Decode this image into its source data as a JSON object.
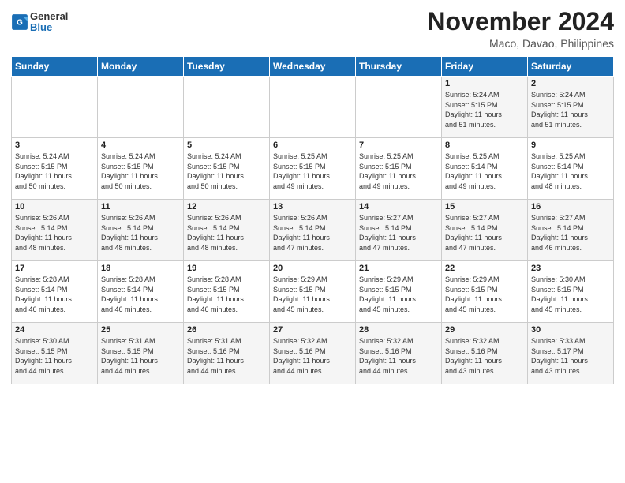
{
  "header": {
    "logo_line1": "General",
    "logo_line2": "Blue",
    "month": "November 2024",
    "location": "Maco, Davao, Philippines"
  },
  "days_of_week": [
    "Sunday",
    "Monday",
    "Tuesday",
    "Wednesday",
    "Thursday",
    "Friday",
    "Saturday"
  ],
  "weeks": [
    [
      {
        "day": "",
        "info": ""
      },
      {
        "day": "",
        "info": ""
      },
      {
        "day": "",
        "info": ""
      },
      {
        "day": "",
        "info": ""
      },
      {
        "day": "",
        "info": ""
      },
      {
        "day": "1",
        "info": "Sunrise: 5:24 AM\nSunset: 5:15 PM\nDaylight: 11 hours\nand 51 minutes."
      },
      {
        "day": "2",
        "info": "Sunrise: 5:24 AM\nSunset: 5:15 PM\nDaylight: 11 hours\nand 51 minutes."
      }
    ],
    [
      {
        "day": "3",
        "info": "Sunrise: 5:24 AM\nSunset: 5:15 PM\nDaylight: 11 hours\nand 50 minutes."
      },
      {
        "day": "4",
        "info": "Sunrise: 5:24 AM\nSunset: 5:15 PM\nDaylight: 11 hours\nand 50 minutes."
      },
      {
        "day": "5",
        "info": "Sunrise: 5:24 AM\nSunset: 5:15 PM\nDaylight: 11 hours\nand 50 minutes."
      },
      {
        "day": "6",
        "info": "Sunrise: 5:25 AM\nSunset: 5:15 PM\nDaylight: 11 hours\nand 49 minutes."
      },
      {
        "day": "7",
        "info": "Sunrise: 5:25 AM\nSunset: 5:15 PM\nDaylight: 11 hours\nand 49 minutes."
      },
      {
        "day": "8",
        "info": "Sunrise: 5:25 AM\nSunset: 5:14 PM\nDaylight: 11 hours\nand 49 minutes."
      },
      {
        "day": "9",
        "info": "Sunrise: 5:25 AM\nSunset: 5:14 PM\nDaylight: 11 hours\nand 48 minutes."
      }
    ],
    [
      {
        "day": "10",
        "info": "Sunrise: 5:26 AM\nSunset: 5:14 PM\nDaylight: 11 hours\nand 48 minutes."
      },
      {
        "day": "11",
        "info": "Sunrise: 5:26 AM\nSunset: 5:14 PM\nDaylight: 11 hours\nand 48 minutes."
      },
      {
        "day": "12",
        "info": "Sunrise: 5:26 AM\nSunset: 5:14 PM\nDaylight: 11 hours\nand 48 minutes."
      },
      {
        "day": "13",
        "info": "Sunrise: 5:26 AM\nSunset: 5:14 PM\nDaylight: 11 hours\nand 47 minutes."
      },
      {
        "day": "14",
        "info": "Sunrise: 5:27 AM\nSunset: 5:14 PM\nDaylight: 11 hours\nand 47 minutes."
      },
      {
        "day": "15",
        "info": "Sunrise: 5:27 AM\nSunset: 5:14 PM\nDaylight: 11 hours\nand 47 minutes."
      },
      {
        "day": "16",
        "info": "Sunrise: 5:27 AM\nSunset: 5:14 PM\nDaylight: 11 hours\nand 46 minutes."
      }
    ],
    [
      {
        "day": "17",
        "info": "Sunrise: 5:28 AM\nSunset: 5:14 PM\nDaylight: 11 hours\nand 46 minutes."
      },
      {
        "day": "18",
        "info": "Sunrise: 5:28 AM\nSunset: 5:14 PM\nDaylight: 11 hours\nand 46 minutes."
      },
      {
        "day": "19",
        "info": "Sunrise: 5:28 AM\nSunset: 5:15 PM\nDaylight: 11 hours\nand 46 minutes."
      },
      {
        "day": "20",
        "info": "Sunrise: 5:29 AM\nSunset: 5:15 PM\nDaylight: 11 hours\nand 45 minutes."
      },
      {
        "day": "21",
        "info": "Sunrise: 5:29 AM\nSunset: 5:15 PM\nDaylight: 11 hours\nand 45 minutes."
      },
      {
        "day": "22",
        "info": "Sunrise: 5:29 AM\nSunset: 5:15 PM\nDaylight: 11 hours\nand 45 minutes."
      },
      {
        "day": "23",
        "info": "Sunrise: 5:30 AM\nSunset: 5:15 PM\nDaylight: 11 hours\nand 45 minutes."
      }
    ],
    [
      {
        "day": "24",
        "info": "Sunrise: 5:30 AM\nSunset: 5:15 PM\nDaylight: 11 hours\nand 44 minutes."
      },
      {
        "day": "25",
        "info": "Sunrise: 5:31 AM\nSunset: 5:15 PM\nDaylight: 11 hours\nand 44 minutes."
      },
      {
        "day": "26",
        "info": "Sunrise: 5:31 AM\nSunset: 5:16 PM\nDaylight: 11 hours\nand 44 minutes."
      },
      {
        "day": "27",
        "info": "Sunrise: 5:32 AM\nSunset: 5:16 PM\nDaylight: 11 hours\nand 44 minutes."
      },
      {
        "day": "28",
        "info": "Sunrise: 5:32 AM\nSunset: 5:16 PM\nDaylight: 11 hours\nand 44 minutes."
      },
      {
        "day": "29",
        "info": "Sunrise: 5:32 AM\nSunset: 5:16 PM\nDaylight: 11 hours\nand 43 minutes."
      },
      {
        "day": "30",
        "info": "Sunrise: 5:33 AM\nSunset: 5:17 PM\nDaylight: 11 hours\nand 43 minutes."
      }
    ]
  ]
}
